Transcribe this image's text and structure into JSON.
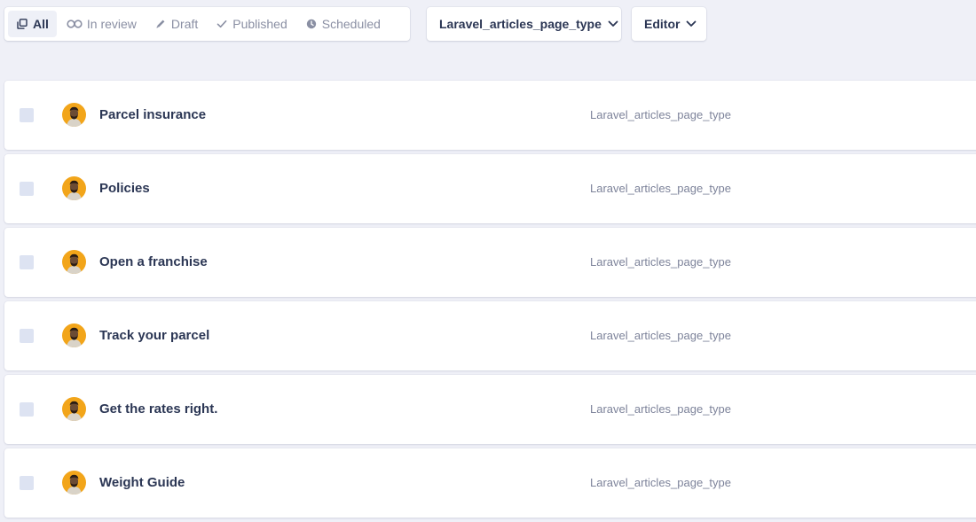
{
  "toolbar": {
    "tabs": [
      {
        "label": "All",
        "icon": "copy-icon",
        "active": true
      },
      {
        "label": "In review",
        "icon": "glasses-icon",
        "active": false
      },
      {
        "label": "Draft",
        "icon": "pencil-icon",
        "active": false
      },
      {
        "label": "Published",
        "icon": "check-icon",
        "active": false
      },
      {
        "label": "Scheduled",
        "icon": "clock-icon",
        "active": false
      }
    ],
    "type_filter": {
      "label": "Laravel_articles_page_type",
      "icon": "chevron-down-icon"
    },
    "editor_filter": {
      "label": "Editor",
      "icon": "chevron-down-icon"
    }
  },
  "articles": [
    {
      "title": "Parcel insurance",
      "page_type": "Laravel_articles_page_type"
    },
    {
      "title": "Policies",
      "page_type": "Laravel_articles_page_type"
    },
    {
      "title": "Open a franchise",
      "page_type": "Laravel_articles_page_type"
    },
    {
      "title": "Track your parcel",
      "page_type": "Laravel_articles_page_type"
    },
    {
      "title": "Get the rates right.",
      "page_type": "Laravel_articles_page_type"
    },
    {
      "title": "Weight Guide",
      "page_type": "Laravel_articles_page_type"
    }
  ],
  "colors": {
    "background": "#eff0f7",
    "text_primary": "#2b3654",
    "text_muted": "#8a8fa3",
    "avatar_bg": "#f2a51a",
    "checkbox": "#dde3f2"
  }
}
